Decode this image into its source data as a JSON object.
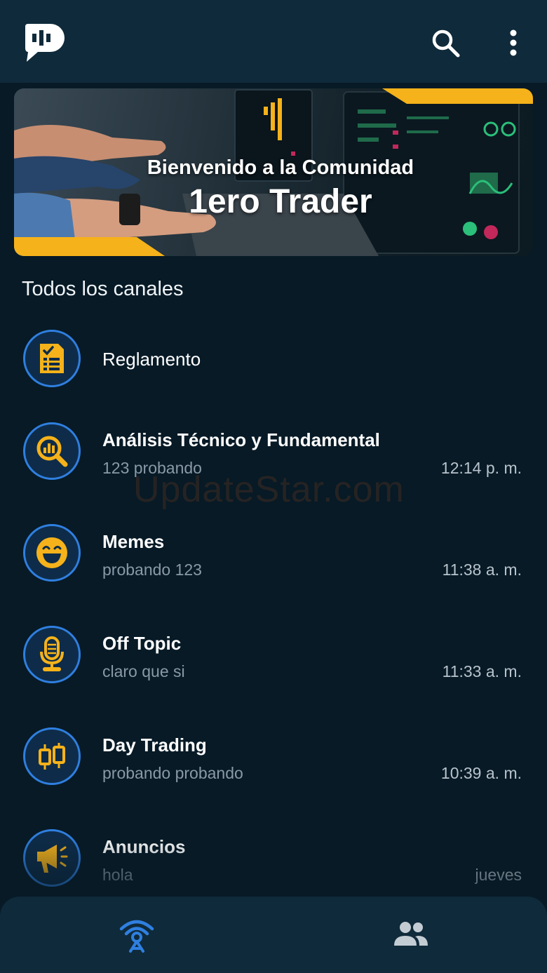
{
  "app": {
    "logo_icon": "chat-bars-logo-icon",
    "search_icon": "search-icon",
    "menu_icon": "more-vert-icon"
  },
  "banner": {
    "line1": "Bienvenido a la Comunidad",
    "line2": "1ero Trader"
  },
  "section_title": "Todos los canales",
  "channels": [
    {
      "name": "Reglamento",
      "icon": "checklist-icon",
      "message": "",
      "time": ""
    },
    {
      "name": "Análisis Técnico y Fundamental",
      "icon": "chart-magnifier-icon",
      "message": "123 probando",
      "time": "12:14 p. m."
    },
    {
      "name": "Memes",
      "icon": "laughing-face-icon",
      "message": "probando 123",
      "time": "11:38 a. m."
    },
    {
      "name": "Off Topic",
      "icon": "microphone-icon",
      "message": "claro que si",
      "time": "11:33 a. m."
    },
    {
      "name": "Day Trading",
      "icon": "candlestick-icon",
      "message": "probando probando",
      "time": "10:39 a. m."
    },
    {
      "name": "Anuncios",
      "icon": "megaphone-icon",
      "message": "hola",
      "time": "jueves"
    }
  ],
  "watermark": "UpdateStar.com",
  "bottom_nav": {
    "channels_icon": "broadcast-tower-icon",
    "members_icon": "group-icon"
  },
  "colors": {
    "background": "#071a26",
    "appbar": "#0f2a3a",
    "accent_blue": "#2f7fe0",
    "accent_yellow": "#f5b21a",
    "muted_text": "#8a99a6"
  }
}
